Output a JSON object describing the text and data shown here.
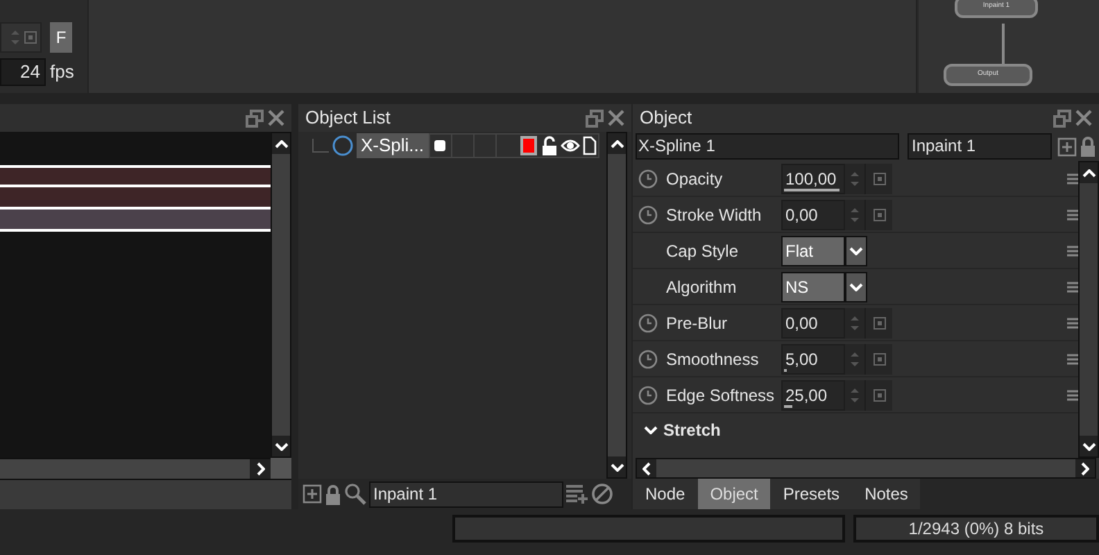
{
  "timing": {
    "frame_button": "F",
    "fps_value": "24",
    "fps_unit": "fps"
  },
  "node_graph": {
    "nodes": [
      {
        "label": "Inpaint 1"
      },
      {
        "label": "Output"
      }
    ]
  },
  "timeline": {
    "tracks": [
      {
        "color": "#3e2527"
      },
      {
        "color": "#3e2527"
      },
      {
        "color": "#4b414b"
      }
    ]
  },
  "object_list": {
    "title": "Object List",
    "items": [
      {
        "name": "X-Spli...",
        "color": "#ff0000"
      }
    ],
    "search": {
      "value": "Inpaint 1"
    }
  },
  "object": {
    "title": "Object",
    "name": "X-Spline 1",
    "layer": "Inpaint 1",
    "properties": [
      {
        "kind": "number",
        "label": "Opacity",
        "value": "100,00",
        "level": 1
      },
      {
        "kind": "number",
        "label": "Stroke Width",
        "value": "0,00"
      },
      {
        "kind": "choice",
        "label": "Cap Style",
        "value": "Flat"
      },
      {
        "kind": "choice",
        "label": "Algorithm",
        "value": "NS"
      },
      {
        "kind": "number",
        "label": "Pre-Blur",
        "value": "0,00"
      },
      {
        "kind": "number",
        "label": "Smoothness",
        "value": "5,00",
        "level": 0.04
      },
      {
        "kind": "number",
        "label": "Edge Softness",
        "value": "25,00",
        "level": 0.15
      }
    ],
    "section": {
      "label": "Stretch",
      "expanded": true
    }
  },
  "tabs": [
    {
      "label": "Node",
      "selected": false
    },
    {
      "label": "Object",
      "selected": true
    },
    {
      "label": "Presets",
      "selected": false
    },
    {
      "label": "Notes",
      "selected": false
    }
  ],
  "status_bar": {
    "frame_info": "1/2943 (0%) 8 bits"
  }
}
